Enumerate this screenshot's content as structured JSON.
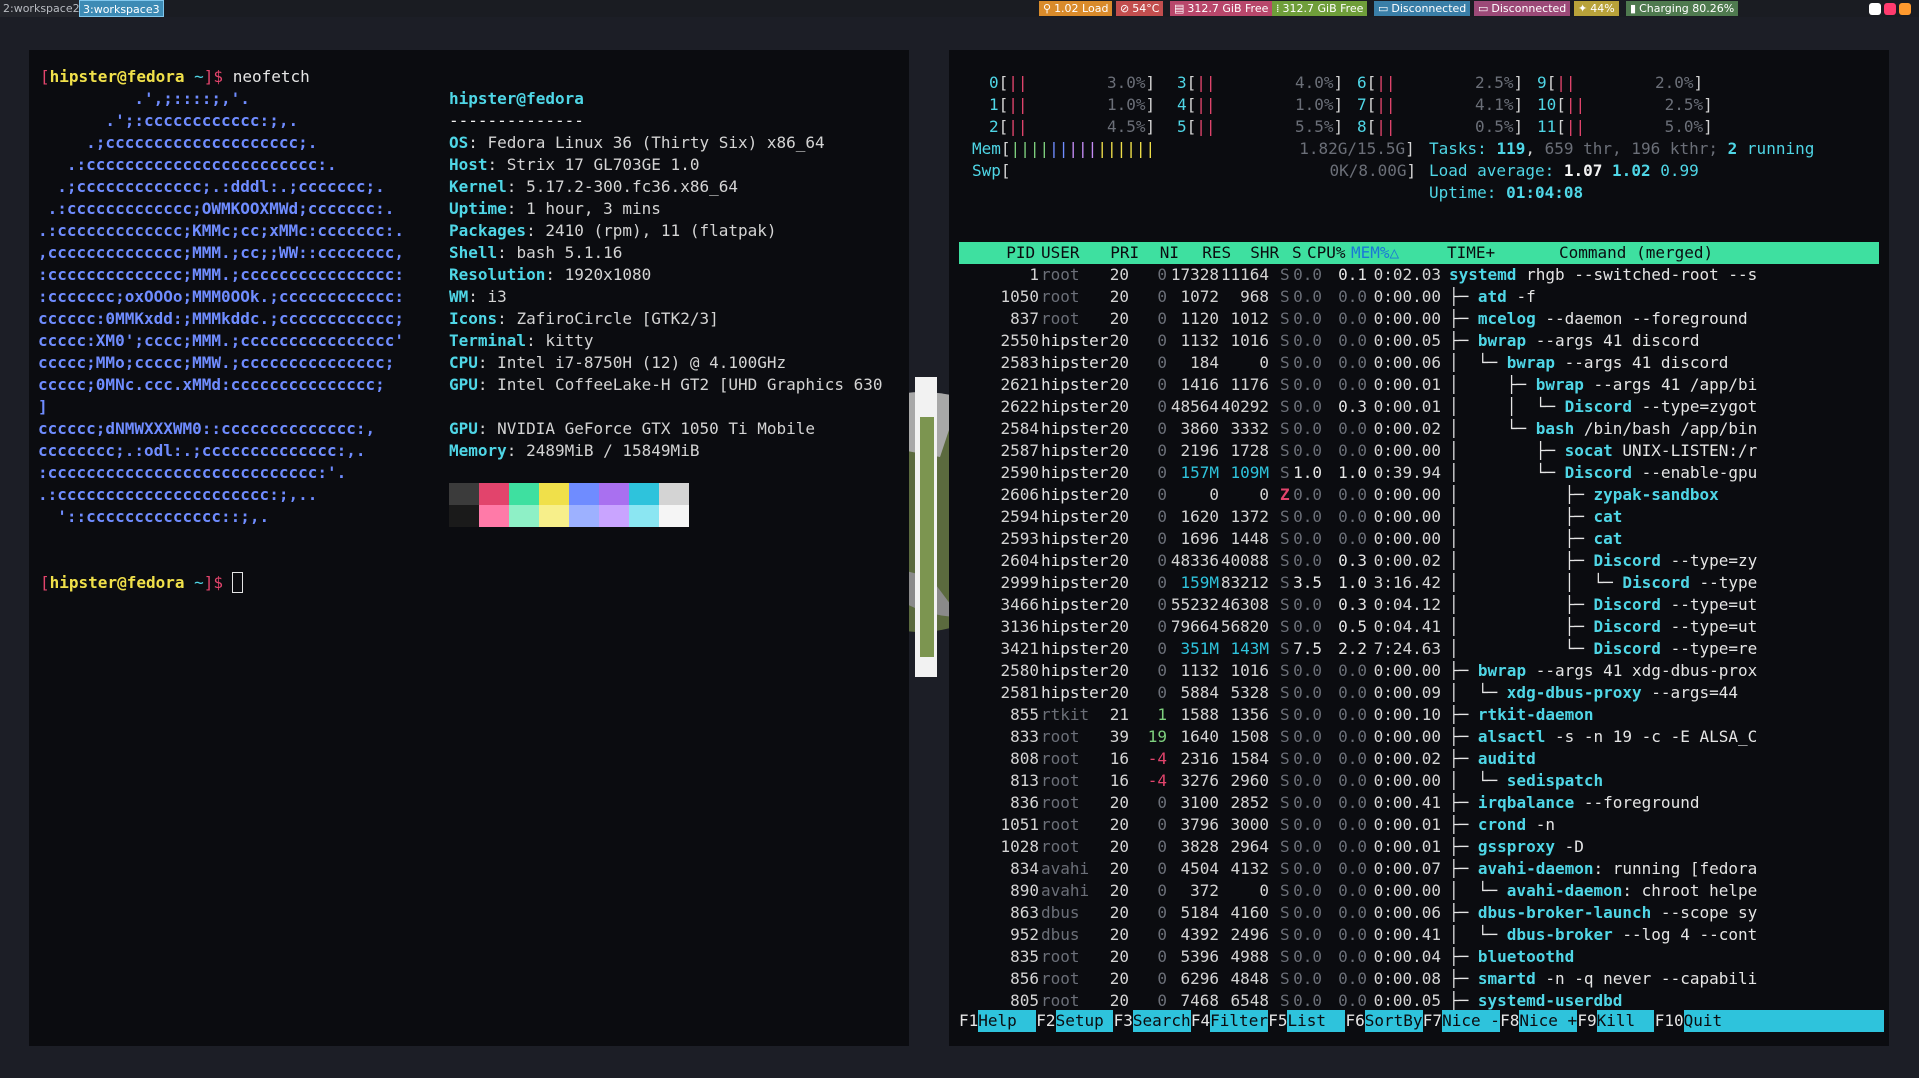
{
  "statusbar": {
    "workspaces": [
      {
        "label": "2:workspace2",
        "active": false
      },
      {
        "label": "3:workspace3",
        "active": true
      }
    ],
    "blocks": [
      {
        "icon": "load-icon",
        "glyph": "⚲",
        "text": "1.02 Load",
        "color": "#d98b2b"
      },
      {
        "icon": "temperature-icon",
        "glyph": "⊘",
        "text": "54°C",
        "color": "#c24e4e"
      },
      {
        "icon": "disk-icon",
        "glyph": "▤",
        "text": "312.7 GiB Free",
        "color": "#b8476b"
      },
      {
        "icon": "disk-icon",
        "glyph": "⁞",
        "text": "312.7 GiB Free",
        "color": "#6f9e3a"
      },
      {
        "icon": "wifi-icon",
        "glyph": "▭",
        "text": "Disconnected",
        "color": "#3a7fa8"
      },
      {
        "icon": "ethernet-icon",
        "glyph": "▭",
        "text": "Disconnected",
        "color": "#9c4a78"
      },
      {
        "icon": "brightness-icon",
        "glyph": "✦",
        "text": "44%",
        "color": "#b8a23a"
      },
      {
        "icon": "battery-icon",
        "glyph": "▮",
        "text": "Charging 80.26%",
        "color": "#4f7a4f"
      }
    ],
    "tray_icons": [
      "discord-icon",
      "app-icon",
      "browser-icon"
    ],
    "tray_colors": [
      "#ffffff",
      "#ff3b6e",
      "#ff9a2e"
    ]
  },
  "left_terminal": {
    "prompt1_user": "hipster@fedora",
    "prompt1_dir": "~",
    "prompt1_cmd": "neofetch",
    "logo": [
      "          .',;::::;,'.",
      "       .';:cccccccccccc:;,.",
      "     .;cccccccccccccccccccc;.",
      "   .:cccccccccccccccccccccccc:.",
      "  .;ccccccccccccc;.:dddl:.;ccccccc;.",
      " .:ccccccccccccc;OWMKOOXMWd;ccccccc:.",
      ".:ccccccccccccc;KMMc;cc;xMMc:ccccccc:.",
      ",cccccccccccccc;MMM.;cc;;WW::cccccccc,",
      ":cccccccccccccc;MMM.;cccccccccccccccc:",
      ":ccccccc;oxOOOo;MMM0OOk.;cccccccccccc:",
      "cccccc:0MMKxdd:;MMMkddc.;cccccccccccc;",
      "ccccc:XM0';cccc;MMM.;cccccccccccccccc'",
      "ccccc;MMo;ccccc;MMW.;ccccccccccccccc;",
      "ccccc;0MNc.ccc.xMMd:ccccccccccccccc;",
      "]",
      "cccccc;dNMWXXXWM0::cccccccccccccc:,",
      "cccccccc;.:odl:.;cccccccccccccc:,.",
      ":cccccccccccccccccccccccccccc:'.",
      ".:cccccccccccccccccccccc:;,..",
      "  '::cccccccccccccc::;,."
    ],
    "info_title": "hipster@fedora",
    "info_sep": "--------------",
    "info": [
      {
        "key": "OS",
        "value": "Fedora Linux 36 (Thirty Six) x86_64"
      },
      {
        "key": "Host",
        "value": "Strix 17 GL703GE 1.0"
      },
      {
        "key": "Kernel",
        "value": "5.17.2-300.fc36.x86_64"
      },
      {
        "key": "Uptime",
        "value": "1 hour, 3 mins"
      },
      {
        "key": "Packages",
        "value": "2410 (rpm), 11 (flatpak)"
      },
      {
        "key": "Shell",
        "value": "bash 5.1.16"
      },
      {
        "key": "Resolution",
        "value": "1920x1080"
      },
      {
        "key": "WM",
        "value": "i3"
      },
      {
        "key": "Icons",
        "value": "ZafiroCircle [GTK2/3]"
      },
      {
        "key": "Terminal",
        "value": "kitty"
      },
      {
        "key": "CPU",
        "value": "Intel i7-8750H (12) @ 4.100GHz"
      },
      {
        "key": "GPU",
        "value": "Intel CoffeeLake-H GT2 [UHD Graphics 630"
      },
      {
        "key": "",
        "value": ""
      },
      {
        "key": "GPU",
        "value": "NVIDIA GeForce GTX 1050 Ti Mobile"
      },
      {
        "key": "Memory",
        "value": "2489MiB / 15849MiB"
      }
    ],
    "swatches_top": [
      "#3b3b3b",
      "#e2446c",
      "#3ee0a0",
      "#f0e04a",
      "#6f8cff",
      "#a970f0",
      "#2ec3dc",
      "#d4d4d4"
    ],
    "swatches_bottom": [
      "#1a1a1a",
      "#ff7aa8",
      "#8ef0c6",
      "#f7ef8a",
      "#9db1ff",
      "#c9a4ff",
      "#8be6f2",
      "#f5f5f5"
    ],
    "prompt2_user": "hipster@fedora",
    "prompt2_dir": "~",
    "cursor": "█"
  },
  "htop": {
    "cpus": [
      {
        "id": "0",
        "pct": "3.0%"
      },
      {
        "id": "3",
        "pct": "4.0%"
      },
      {
        "id": "6",
        "pct": "2.5%"
      },
      {
        "id": "9",
        "pct": "2.0%"
      },
      {
        "id": "1",
        "pct": "1.0%"
      },
      {
        "id": "4",
        "pct": "1.0%"
      },
      {
        "id": "7",
        "pct": "4.1%"
      },
      {
        "id": "10",
        "pct": "2.5%"
      },
      {
        "id": "2",
        "pct": "4.5%"
      },
      {
        "id": "5",
        "pct": "5.5%"
      },
      {
        "id": "8",
        "pct": "0.5%"
      },
      {
        "id": "11",
        "pct": "5.0%"
      }
    ],
    "mem_label": "Mem",
    "mem_value": "1.82G/15.5G",
    "swp_label": "Swp",
    "swp_value": "0K/8.00G",
    "tasks_label": "Tasks:",
    "tasks_count": "119",
    "tasks_thr": "659 thr, 196 kthr;",
    "running_count": "2",
    "running_label": "running",
    "load_label": "Load average:",
    "load1": "1.07",
    "load5": "1.02",
    "load15": "0.99",
    "uptime_label": "Uptime:",
    "uptime_value": "01:04:08",
    "columns": [
      "PID",
      "USER",
      "PRI",
      "NI",
      "RES",
      "SHR",
      "S",
      "CPU%",
      "MEM%△",
      "TIME+",
      "Command (merged)"
    ],
    "processes": [
      {
        "pid": "1",
        "user": "root",
        "pri": "20",
        "ni": "0",
        "res": "17328",
        "shr": "11164",
        "s": "S",
        "cpu": "0.0",
        "mem": "0.1",
        "time": "0:02.03",
        "tree": "",
        "cmd": "systemd",
        "args": " rhgb --switched-root --s"
      },
      {
        "pid": "1050",
        "user": "root",
        "pri": "20",
        "ni": "0",
        "res": "1072",
        "shr": "968",
        "s": "S",
        "cpu": "0.0",
        "mem": "0.0",
        "time": "0:00.00",
        "tree": "├─ ",
        "cmd": "atd",
        "args": " -f"
      },
      {
        "pid": "837",
        "user": "root",
        "pri": "20",
        "ni": "0",
        "res": "1120",
        "shr": "1012",
        "s": "S",
        "cpu": "0.0",
        "mem": "0.0",
        "time": "0:00.00",
        "tree": "├─ ",
        "cmd": "mcelog",
        "args": " --daemon --foreground"
      },
      {
        "pid": "2550",
        "user": "hipster",
        "pri": "20",
        "ni": "0",
        "res": "1132",
        "shr": "1016",
        "s": "S",
        "cpu": "0.0",
        "mem": "0.0",
        "time": "0:00.05",
        "tree": "├─ ",
        "cmd": "bwrap",
        "args": " --args 41 discord"
      },
      {
        "pid": "2583",
        "user": "hipster",
        "pri": "20",
        "ni": "0",
        "res": "184",
        "shr": "0",
        "s": "S",
        "cpu": "0.0",
        "mem": "0.0",
        "time": "0:00.06",
        "tree": "│  └─ ",
        "cmd": "bwrap",
        "args": " --args 41 discord"
      },
      {
        "pid": "2621",
        "user": "hipster",
        "pri": "20",
        "ni": "0",
        "res": "1416",
        "shr": "1176",
        "s": "S",
        "cpu": "0.0",
        "mem": "0.0",
        "time": "0:00.01",
        "tree": "│     ├─ ",
        "cmd": "bwrap",
        "args": " --args 41 /app/bi"
      },
      {
        "pid": "2622",
        "user": "hipster",
        "pri": "20",
        "ni": "0",
        "res": "48564",
        "shr": "40292",
        "s": "S",
        "cpu": "0.0",
        "mem": "0.3",
        "time": "0:00.01",
        "tree": "│     │  └─ ",
        "cmd": "Discord",
        "args": " --type=zygot"
      },
      {
        "pid": "2584",
        "user": "hipster",
        "pri": "20",
        "ni": "0",
        "res": "3860",
        "shr": "3332",
        "s": "S",
        "cpu": "0.0",
        "mem": "0.0",
        "time": "0:00.02",
        "tree": "│     └─ ",
        "cmd": "bash",
        "args": " /bin/bash /app/bin"
      },
      {
        "pid": "2587",
        "user": "hipster",
        "pri": "20",
        "ni": "0",
        "res": "2196",
        "shr": "1728",
        "s": "S",
        "cpu": "0.0",
        "mem": "0.0",
        "time": "0:00.00",
        "tree": "│        ├─ ",
        "cmd": "socat",
        "args": " UNIX-LISTEN:/r"
      },
      {
        "pid": "2590",
        "user": "hipster",
        "pri": "20",
        "ni": "0",
        "res": "157M",
        "shr": "109M",
        "s": "S",
        "cpu": "1.0",
        "mem": "1.0",
        "time": "0:39.94",
        "tree": "│        └─ ",
        "cmd": "Discord",
        "args": " --enable-gpu"
      },
      {
        "pid": "2606",
        "user": "hipster",
        "pri": "20",
        "ni": "0",
        "res": "0",
        "shr": "0",
        "s": "Z",
        "cpu": "0.0",
        "mem": "0.0",
        "time": "0:00.00",
        "tree": "│           ├─ ",
        "cmd": "zypak-sandbox",
        "args": ""
      },
      {
        "pid": "2594",
        "user": "hipster",
        "pri": "20",
        "ni": "0",
        "res": "1620",
        "shr": "1372",
        "s": "S",
        "cpu": "0.0",
        "mem": "0.0",
        "time": "0:00.00",
        "tree": "│           ├─ ",
        "cmd": "cat",
        "args": ""
      },
      {
        "pid": "2593",
        "user": "hipster",
        "pri": "20",
        "ni": "0",
        "res": "1696",
        "shr": "1448",
        "s": "S",
        "cpu": "0.0",
        "mem": "0.0",
        "time": "0:00.00",
        "tree": "│           ├─ ",
        "cmd": "cat",
        "args": ""
      },
      {
        "pid": "2604",
        "user": "hipster",
        "pri": "20",
        "ni": "0",
        "res": "48336",
        "shr": "40088",
        "s": "S",
        "cpu": "0.0",
        "mem": "0.3",
        "time": "0:00.02",
        "tree": "│           ├─ ",
        "cmd": "Discord",
        "args": " --type=zy"
      },
      {
        "pid": "2999",
        "user": "hipster",
        "pri": "20",
        "ni": "0",
        "res": "159M",
        "shr": "83212",
        "s": "S",
        "cpu": "3.5",
        "mem": "1.0",
        "time": "3:16.42",
        "tree": "│           │  └─ ",
        "cmd": "Discord",
        "args": " --type"
      },
      {
        "pid": "3466",
        "user": "hipster",
        "pri": "20",
        "ni": "0",
        "res": "55232",
        "shr": "46308",
        "s": "S",
        "cpu": "0.0",
        "mem": "0.3",
        "time": "0:04.12",
        "tree": "│           ├─ ",
        "cmd": "Discord",
        "args": " --type=ut"
      },
      {
        "pid": "3136",
        "user": "hipster",
        "pri": "20",
        "ni": "0",
        "res": "79664",
        "shr": "56820",
        "s": "S",
        "cpu": "0.0",
        "mem": "0.5",
        "time": "0:04.41",
        "tree": "│           ├─ ",
        "cmd": "Discord",
        "args": " --type=ut"
      },
      {
        "pid": "3421",
        "user": "hipster",
        "pri": "20",
        "ni": "0",
        "res": "351M",
        "shr": "143M",
        "s": "S",
        "cpu": "7.5",
        "mem": "2.2",
        "time": "7:24.63",
        "tree": "│           └─ ",
        "cmd": "Discord",
        "args": " --type=re"
      },
      {
        "pid": "2580",
        "user": "hipster",
        "pri": "20",
        "ni": "0",
        "res": "1132",
        "shr": "1016",
        "s": "S",
        "cpu": "0.0",
        "mem": "0.0",
        "time": "0:00.00",
        "tree": "├─ ",
        "cmd": "bwrap",
        "args": " --args 41 xdg-dbus-prox"
      },
      {
        "pid": "2581",
        "user": "hipster",
        "pri": "20",
        "ni": "0",
        "res": "5884",
        "shr": "5328",
        "s": "S",
        "cpu": "0.0",
        "mem": "0.0",
        "time": "0:00.09",
        "tree": "│  └─ ",
        "cmd": "xdg-dbus-proxy",
        "args": " --args=44"
      },
      {
        "pid": "855",
        "user": "rtkit",
        "pri": "21",
        "ni": "1",
        "res": "1588",
        "shr": "1356",
        "s": "S",
        "cpu": "0.0",
        "mem": "0.0",
        "time": "0:00.10",
        "tree": "├─ ",
        "cmd": "rtkit-daemon",
        "args": ""
      },
      {
        "pid": "833",
        "user": "root",
        "pri": "39",
        "ni": "19",
        "res": "1640",
        "shr": "1508",
        "s": "S",
        "cpu": "0.0",
        "mem": "0.0",
        "time": "0:00.00",
        "tree": "├─ ",
        "cmd": "alsactl",
        "args": " -s -n 19 -c -E ALSA_C"
      },
      {
        "pid": "808",
        "user": "root",
        "pri": "16",
        "ni": "-4",
        "res": "2316",
        "shr": "1584",
        "s": "S",
        "cpu": "0.0",
        "mem": "0.0",
        "time": "0:00.02",
        "tree": "├─ ",
        "cmd": "auditd",
        "args": ""
      },
      {
        "pid": "813",
        "user": "root",
        "pri": "16",
        "ni": "-4",
        "res": "3276",
        "shr": "2960",
        "s": "S",
        "cpu": "0.0",
        "mem": "0.0",
        "time": "0:00.00",
        "tree": "│  └─ ",
        "cmd": "sedispatch",
        "args": ""
      },
      {
        "pid": "836",
        "user": "root",
        "pri": "20",
        "ni": "0",
        "res": "3100",
        "shr": "2852",
        "s": "S",
        "cpu": "0.0",
        "mem": "0.0",
        "time": "0:00.41",
        "tree": "├─ ",
        "cmd": "irqbalance",
        "args": " --foreground"
      },
      {
        "pid": "1051",
        "user": "root",
        "pri": "20",
        "ni": "0",
        "res": "3796",
        "shr": "3000",
        "s": "S",
        "cpu": "0.0",
        "mem": "0.0",
        "time": "0:00.01",
        "tree": "├─ ",
        "cmd": "crond",
        "args": " -n"
      },
      {
        "pid": "1028",
        "user": "root",
        "pri": "20",
        "ni": "0",
        "res": "3828",
        "shr": "2964",
        "s": "S",
        "cpu": "0.0",
        "mem": "0.0",
        "time": "0:00.01",
        "tree": "├─ ",
        "cmd": "gssproxy",
        "args": " -D"
      },
      {
        "pid": "834",
        "user": "avahi",
        "pri": "20",
        "ni": "0",
        "res": "4504",
        "shr": "4132",
        "s": "S",
        "cpu": "0.0",
        "mem": "0.0",
        "time": "0:00.07",
        "tree": "├─ ",
        "cmd": "avahi-daemon",
        "args": ": running [fedora"
      },
      {
        "pid": "890",
        "user": "avahi",
        "pri": "20",
        "ni": "0",
        "res": "372",
        "shr": "0",
        "s": "S",
        "cpu": "0.0",
        "mem": "0.0",
        "time": "0:00.00",
        "tree": "│  └─ ",
        "cmd": "avahi-daemon",
        "args": ": chroot helpe"
      },
      {
        "pid": "863",
        "user": "dbus",
        "pri": "20",
        "ni": "0",
        "res": "5184",
        "shr": "4160",
        "s": "S",
        "cpu": "0.0",
        "mem": "0.0",
        "time": "0:00.06",
        "tree": "├─ ",
        "cmd": "dbus-broker-launch",
        "args": " --scope sy"
      },
      {
        "pid": "952",
        "user": "dbus",
        "pri": "20",
        "ni": "0",
        "res": "4392",
        "shr": "2496",
        "s": "S",
        "cpu": "0.0",
        "mem": "0.0",
        "time": "0:00.41",
        "tree": "│  └─ ",
        "cmd": "dbus-broker",
        "args": " --log 4 --cont"
      },
      {
        "pid": "835",
        "user": "root",
        "pri": "20",
        "ni": "0",
        "res": "5396",
        "shr": "4988",
        "s": "S",
        "cpu": "0.0",
        "mem": "0.0",
        "time": "0:00.04",
        "tree": "├─ ",
        "cmd": "bluetoothd",
        "args": ""
      },
      {
        "pid": "856",
        "user": "root",
        "pri": "20",
        "ni": "0",
        "res": "6296",
        "shr": "4848",
        "s": "S",
        "cpu": "0.0",
        "mem": "0.0",
        "time": "0:00.08",
        "tree": "├─ ",
        "cmd": "smartd",
        "args": " -n -q never --capabili"
      },
      {
        "pid": "805",
        "user": "root",
        "pri": "20",
        "ni": "0",
        "res": "7468",
        "shr": "6548",
        "s": "S",
        "cpu": "0.0",
        "mem": "0.0",
        "time": "0:00.05",
        "tree": "├─ ",
        "cmd": "systemd-userdbd",
        "args": ""
      }
    ],
    "fkeys": [
      {
        "key": "F1",
        "label": "Help  "
      },
      {
        "key": "F2",
        "label": "Setup "
      },
      {
        "key": "F3",
        "label": "Search"
      },
      {
        "key": "F4",
        "label": "Filter"
      },
      {
        "key": "F5",
        "label": "List  "
      },
      {
        "key": "F6",
        "label": "SortBy"
      },
      {
        "key": "F7",
        "label": "Nice -"
      },
      {
        "key": "F8",
        "label": "Nice +"
      },
      {
        "key": "F9",
        "label": "Kill  "
      },
      {
        "key": "F10",
        "label": "Quit      "
      }
    ]
  }
}
